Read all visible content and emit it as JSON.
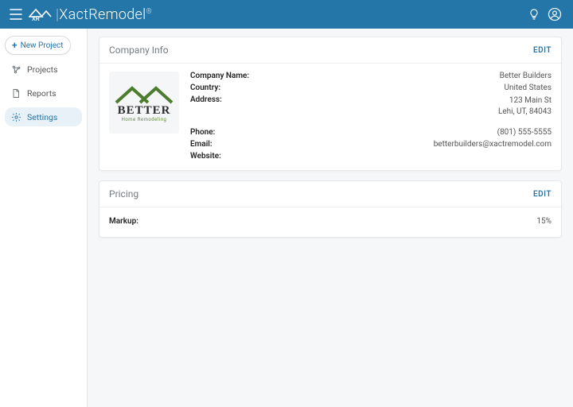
{
  "brand": {
    "name": "XactRemodel",
    "regmark": "®"
  },
  "header_icons": {
    "tip": "lightbulb-icon",
    "account": "account-icon"
  },
  "sidebar": {
    "new_project_label": "New Project",
    "items": [
      {
        "label": "Projects",
        "icon": "projects-icon",
        "active": false
      },
      {
        "label": "Reports",
        "icon": "reports-icon",
        "active": false
      },
      {
        "label": "Settings",
        "icon": "settings-icon",
        "active": true
      }
    ]
  },
  "cards": {
    "company": {
      "title": "Company Info",
      "edit_label": "EDIT",
      "logo_word": "BETTER",
      "logo_sub": "Home Remodeling",
      "fields": {
        "company_name_label": "Company Name:",
        "company_name_value": "Better Builders",
        "country_label": "Country:",
        "country_value": "United States",
        "address_label": "Address:",
        "address_line1": "123 Main St",
        "address_line2": "Lehi, UT, 84043",
        "phone_label": "Phone:",
        "phone_value": "(801) 555-5555",
        "email_label": "Email:",
        "email_value": "betterbuilders@xactremodel.com",
        "website_label": "Website:",
        "website_value": ""
      }
    },
    "pricing": {
      "title": "Pricing",
      "edit_label": "EDIT",
      "markup_label": "Markup:",
      "markup_value": "15%"
    }
  }
}
